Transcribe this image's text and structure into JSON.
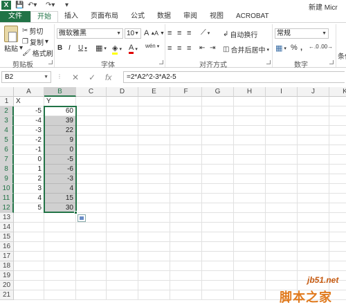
{
  "window": {
    "app_icon": "X",
    "title": "新建 Micr"
  },
  "quick_access": {
    "save_icon": "save-icon",
    "undo_icon": "undo-icon",
    "redo_icon": "redo-icon",
    "customize_icon": "customize-quick-access-icon"
  },
  "tabs": [
    {
      "label": "文件"
    },
    {
      "label": "开始"
    },
    {
      "label": "插入"
    },
    {
      "label": "页面布局"
    },
    {
      "label": "公式"
    },
    {
      "label": "数据"
    },
    {
      "label": "审阅"
    },
    {
      "label": "视图"
    },
    {
      "label": "ACROBAT"
    }
  ],
  "ribbon": {
    "clipboard": {
      "paste": "粘贴",
      "cut": "剪切",
      "copy": "复制",
      "format_painter": "格式刷",
      "group": "剪贴板"
    },
    "font": {
      "font_name": "微软雅黑",
      "font_size": "10",
      "grow": "A",
      "shrink": "A",
      "bold": "B",
      "italic": "I",
      "underline": "U",
      "font_color": "A",
      "wen": "wén",
      "group": "字体"
    },
    "alignment": {
      "wrap_text": "自动换行",
      "merge_center": "合并后居中",
      "group": "对齐方式"
    },
    "number": {
      "format": "常规",
      "percent": "%",
      "comma": ",",
      "group": "数字",
      "cond_format_partial": "条件"
    }
  },
  "formula_bar": {
    "name_box": "B2",
    "cancel": "✕",
    "enter": "✓",
    "fx": "fx",
    "formula": "=2*A2^2-3*A2-5"
  },
  "grid": {
    "columns": [
      "A",
      "B",
      "C",
      "D",
      "E",
      "F",
      "G",
      "H",
      "I",
      "J",
      "K"
    ],
    "rows": [
      "1",
      "2",
      "3",
      "4",
      "5",
      "6",
      "7",
      "8",
      "9",
      "10",
      "11",
      "12",
      "13",
      "14",
      "15",
      "16",
      "17",
      "18",
      "19",
      "20",
      "21"
    ],
    "header_row": {
      "a": "X",
      "b": "Y"
    },
    "data": [
      {
        "x": "-5",
        "y": "60"
      },
      {
        "x": "-4",
        "y": "39"
      },
      {
        "x": "-3",
        "y": "22"
      },
      {
        "x": "-2",
        "y": "9"
      },
      {
        "x": "-1",
        "y": "0"
      },
      {
        "x": "0",
        "y": "-5"
      },
      {
        "x": "1",
        "y": "-6"
      },
      {
        "x": "2",
        "y": "-3"
      },
      {
        "x": "3",
        "y": "4"
      },
      {
        "x": "4",
        "y": "15"
      },
      {
        "x": "5",
        "y": "30"
      }
    ]
  },
  "watermark": {
    "site": "jb51.net",
    "name": "脚本之家"
  },
  "colors": {
    "accent": "#217346",
    "selection_fill": "#d0d0d0"
  }
}
